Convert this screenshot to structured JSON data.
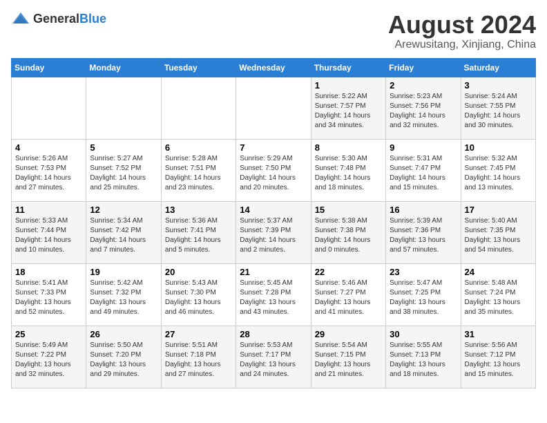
{
  "header": {
    "logo_general": "General",
    "logo_blue": "Blue",
    "month_year": "August 2024",
    "location": "Arewusitang, Xinjiang, China"
  },
  "weekdays": [
    "Sunday",
    "Monday",
    "Tuesday",
    "Wednesday",
    "Thursday",
    "Friday",
    "Saturday"
  ],
  "weeks": [
    [
      {
        "day": "",
        "content": ""
      },
      {
        "day": "",
        "content": ""
      },
      {
        "day": "",
        "content": ""
      },
      {
        "day": "",
        "content": ""
      },
      {
        "day": "1",
        "content": "Sunrise: 5:22 AM\nSunset: 7:57 PM\nDaylight: 14 hours\nand 34 minutes."
      },
      {
        "day": "2",
        "content": "Sunrise: 5:23 AM\nSunset: 7:56 PM\nDaylight: 14 hours\nand 32 minutes."
      },
      {
        "day": "3",
        "content": "Sunrise: 5:24 AM\nSunset: 7:55 PM\nDaylight: 14 hours\nand 30 minutes."
      }
    ],
    [
      {
        "day": "4",
        "content": "Sunrise: 5:26 AM\nSunset: 7:53 PM\nDaylight: 14 hours\nand 27 minutes."
      },
      {
        "day": "5",
        "content": "Sunrise: 5:27 AM\nSunset: 7:52 PM\nDaylight: 14 hours\nand 25 minutes."
      },
      {
        "day": "6",
        "content": "Sunrise: 5:28 AM\nSunset: 7:51 PM\nDaylight: 14 hours\nand 23 minutes."
      },
      {
        "day": "7",
        "content": "Sunrise: 5:29 AM\nSunset: 7:50 PM\nDaylight: 14 hours\nand 20 minutes."
      },
      {
        "day": "8",
        "content": "Sunrise: 5:30 AM\nSunset: 7:48 PM\nDaylight: 14 hours\nand 18 minutes."
      },
      {
        "day": "9",
        "content": "Sunrise: 5:31 AM\nSunset: 7:47 PM\nDaylight: 14 hours\nand 15 minutes."
      },
      {
        "day": "10",
        "content": "Sunrise: 5:32 AM\nSunset: 7:45 PM\nDaylight: 14 hours\nand 13 minutes."
      }
    ],
    [
      {
        "day": "11",
        "content": "Sunrise: 5:33 AM\nSunset: 7:44 PM\nDaylight: 14 hours\nand 10 minutes."
      },
      {
        "day": "12",
        "content": "Sunrise: 5:34 AM\nSunset: 7:42 PM\nDaylight: 14 hours\nand 7 minutes."
      },
      {
        "day": "13",
        "content": "Sunrise: 5:36 AM\nSunset: 7:41 PM\nDaylight: 14 hours\nand 5 minutes."
      },
      {
        "day": "14",
        "content": "Sunrise: 5:37 AM\nSunset: 7:39 PM\nDaylight: 14 hours\nand 2 minutes."
      },
      {
        "day": "15",
        "content": "Sunrise: 5:38 AM\nSunset: 7:38 PM\nDaylight: 14 hours\nand 0 minutes."
      },
      {
        "day": "16",
        "content": "Sunrise: 5:39 AM\nSunset: 7:36 PM\nDaylight: 13 hours\nand 57 minutes."
      },
      {
        "day": "17",
        "content": "Sunrise: 5:40 AM\nSunset: 7:35 PM\nDaylight: 13 hours\nand 54 minutes."
      }
    ],
    [
      {
        "day": "18",
        "content": "Sunrise: 5:41 AM\nSunset: 7:33 PM\nDaylight: 13 hours\nand 52 minutes."
      },
      {
        "day": "19",
        "content": "Sunrise: 5:42 AM\nSunset: 7:32 PM\nDaylight: 13 hours\nand 49 minutes."
      },
      {
        "day": "20",
        "content": "Sunrise: 5:43 AM\nSunset: 7:30 PM\nDaylight: 13 hours\nand 46 minutes."
      },
      {
        "day": "21",
        "content": "Sunrise: 5:45 AM\nSunset: 7:28 PM\nDaylight: 13 hours\nand 43 minutes."
      },
      {
        "day": "22",
        "content": "Sunrise: 5:46 AM\nSunset: 7:27 PM\nDaylight: 13 hours\nand 41 minutes."
      },
      {
        "day": "23",
        "content": "Sunrise: 5:47 AM\nSunset: 7:25 PM\nDaylight: 13 hours\nand 38 minutes."
      },
      {
        "day": "24",
        "content": "Sunrise: 5:48 AM\nSunset: 7:24 PM\nDaylight: 13 hours\nand 35 minutes."
      }
    ],
    [
      {
        "day": "25",
        "content": "Sunrise: 5:49 AM\nSunset: 7:22 PM\nDaylight: 13 hours\nand 32 minutes."
      },
      {
        "day": "26",
        "content": "Sunrise: 5:50 AM\nSunset: 7:20 PM\nDaylight: 13 hours\nand 29 minutes."
      },
      {
        "day": "27",
        "content": "Sunrise: 5:51 AM\nSunset: 7:18 PM\nDaylight: 13 hours\nand 27 minutes."
      },
      {
        "day": "28",
        "content": "Sunrise: 5:53 AM\nSunset: 7:17 PM\nDaylight: 13 hours\nand 24 minutes."
      },
      {
        "day": "29",
        "content": "Sunrise: 5:54 AM\nSunset: 7:15 PM\nDaylight: 13 hours\nand 21 minutes."
      },
      {
        "day": "30",
        "content": "Sunrise: 5:55 AM\nSunset: 7:13 PM\nDaylight: 13 hours\nand 18 minutes."
      },
      {
        "day": "31",
        "content": "Sunrise: 5:56 AM\nSunset: 7:12 PM\nDaylight: 13 hours\nand 15 minutes."
      }
    ]
  ]
}
